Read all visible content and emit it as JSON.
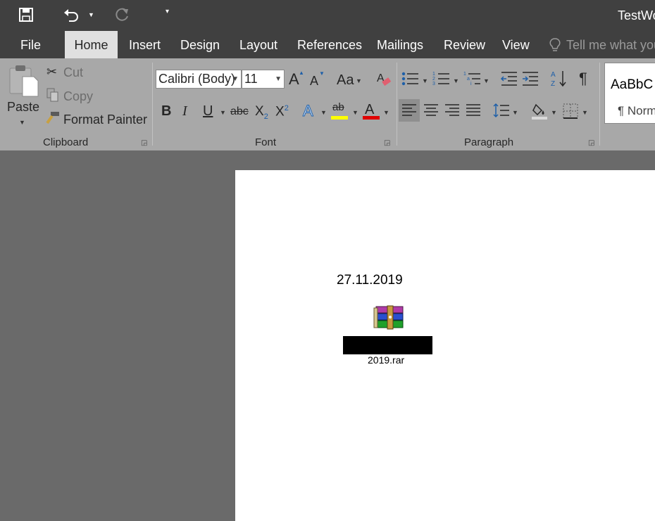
{
  "app": {
    "title": "TestWo"
  },
  "tabs": [
    {
      "label": "File"
    },
    {
      "label": "Home"
    },
    {
      "label": "Insert"
    },
    {
      "label": "Design"
    },
    {
      "label": "Layout"
    },
    {
      "label": "References"
    },
    {
      "label": "Mailings"
    },
    {
      "label": "Review"
    },
    {
      "label": "View"
    }
  ],
  "tell_me": {
    "placeholder": "Tell me what you"
  },
  "clipboard": {
    "paste_label": "Paste",
    "cut_label": "Cut",
    "copy_label": "Copy",
    "format_painter_label": "Format Painter",
    "group_label": "Clipboard"
  },
  "font": {
    "font_name": "Calibri (Body)",
    "font_size": "11",
    "group_label": "Font",
    "bold_glyph": "B",
    "italic_glyph": "I",
    "underline_glyph": "U",
    "strike_glyph": "abc",
    "subscript_glyph": "X",
    "subscript_mark": "2",
    "superscript_glyph": "X",
    "superscript_mark": "2",
    "grow_glyph": "A",
    "shrink_glyph": "A",
    "case_glyph": "Aa",
    "effects_glyph": "A",
    "highlight_glyph": "ab",
    "font_color_glyph": "A",
    "highlight_color": "#ffff00",
    "font_color": "#e00000"
  },
  "paragraph": {
    "group_label": "Paragraph",
    "pilcrow_glyph": "¶"
  },
  "styles": {
    "preview_text": "AaBbC",
    "normal_label": "¶ Norm"
  },
  "document": {
    "date_text": "27.11.2019",
    "attachment_name": "2019.rar"
  }
}
